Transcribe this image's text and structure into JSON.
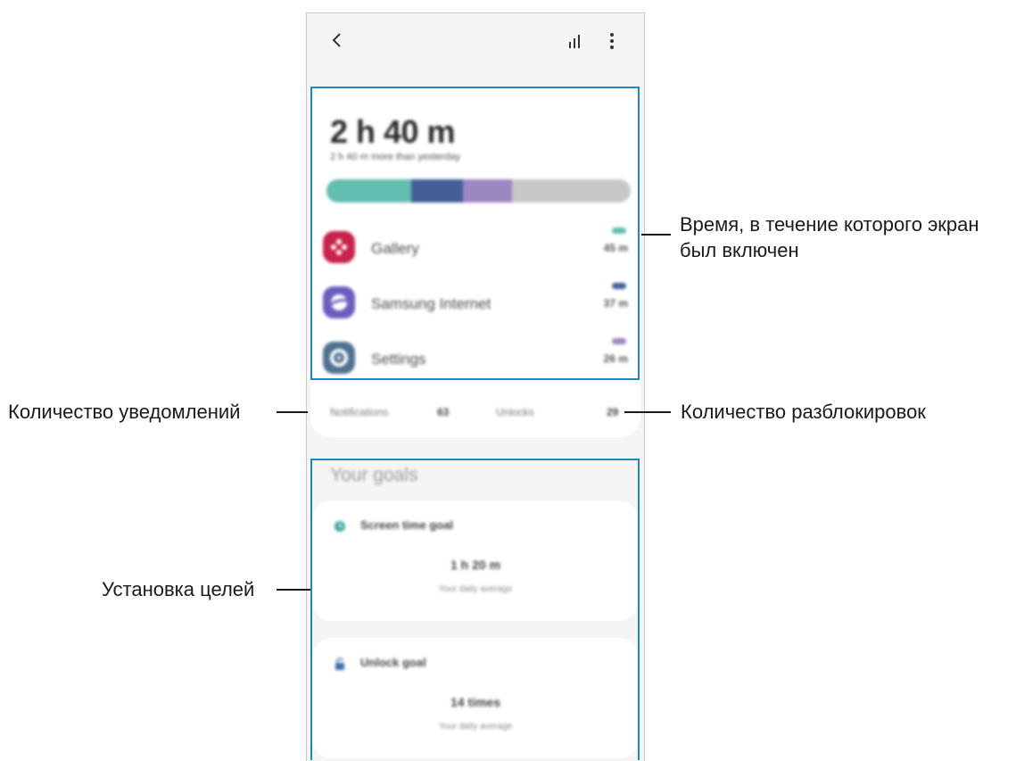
{
  "usage": {
    "total_time": "2 h 40 m",
    "delta_text": "2 h 40 m more than yesterday",
    "segments": [
      {
        "color": "#63bdb0",
        "fraction": 0.28
      },
      {
        "color": "#445e97",
        "fraction": 0.17
      },
      {
        "color": "#9c87c2",
        "fraction": 0.16
      },
      {
        "color": "#c8c8c8",
        "fraction": 0.39
      }
    ],
    "apps": [
      {
        "name": "Gallery",
        "time": "45 m",
        "color": "#63bdb0",
        "icon": "gallery-icon",
        "icon_color": "#c8234a"
      },
      {
        "name": "Samsung Internet",
        "time": "37 m",
        "color": "#445e97",
        "icon": "internet-icon",
        "icon_color": "#6a5fbf"
      },
      {
        "name": "Settings",
        "time": "26 m",
        "color": "#9c87c2",
        "icon": "settings-icon",
        "icon_color": "#4f7290"
      }
    ]
  },
  "counts": {
    "notifications_label": "Notifications",
    "notifications_value": "63",
    "unlocks_label": "Unlocks",
    "unlocks_value": "29"
  },
  "goals": {
    "title": "Your goals",
    "screen_time": {
      "label": "Screen time goal",
      "value": "1 h 20 m",
      "sub": "Your daily average",
      "icon": "clock-icon"
    },
    "unlock": {
      "label": "Unlock goal",
      "value": "14 times",
      "sub": "Your daily average",
      "icon": "lock-icon"
    }
  },
  "callouts": {
    "screen_time_line1": "Время, в течение которого экран",
    "screen_time_line2": "был включен",
    "notifications": "Количество уведомлений",
    "unlocks": "Количество разблокировок",
    "goals": "Установка целей"
  },
  "colors": {
    "highlight": "#1e86c2"
  }
}
